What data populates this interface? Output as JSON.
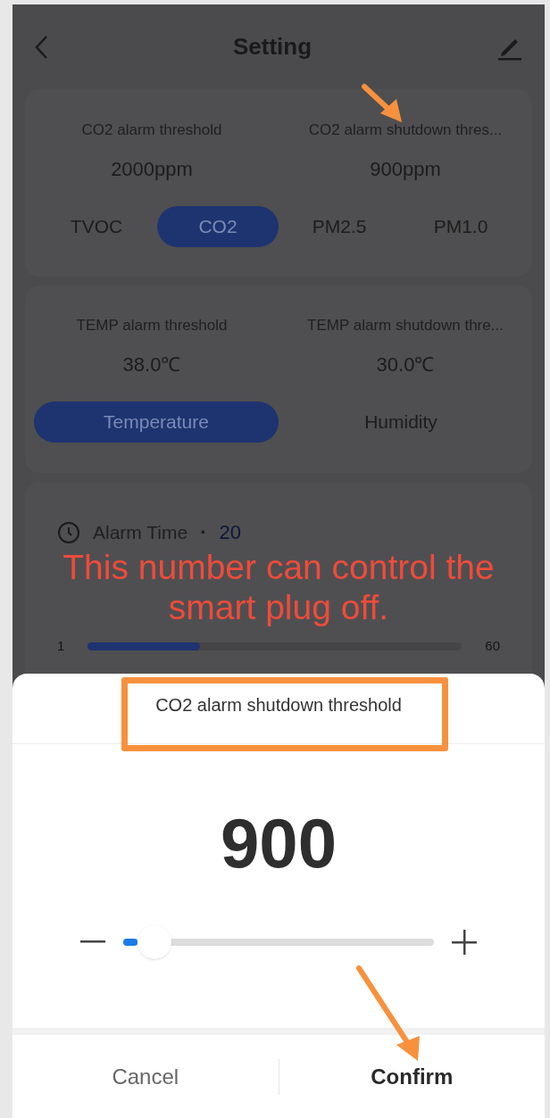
{
  "header": {
    "title": "Setting"
  },
  "air_card": {
    "readings": [
      {
        "label": "CO2 alarm threshold",
        "value": "2000ppm"
      },
      {
        "label": "CO2 alarm shutdown thres...",
        "value": "900ppm"
      }
    ],
    "tabs": [
      {
        "label": "TVOC",
        "selected": false
      },
      {
        "label": "CO2",
        "selected": true
      },
      {
        "label": "PM2.5",
        "selected": false
      },
      {
        "label": "PM1.0",
        "selected": false
      }
    ]
  },
  "temp_card": {
    "readings": [
      {
        "label": "TEMP alarm threshold",
        "value": "38.0℃"
      },
      {
        "label": "TEMP alarm shutdown thre...",
        "value": "30.0℃"
      }
    ],
    "tabs": [
      {
        "label": "Temperature",
        "selected": true
      },
      {
        "label": "Humidity",
        "selected": false
      }
    ]
  },
  "alarm_time": {
    "label": "Alarm Time",
    "separator": "·",
    "value": "20",
    "min": "1",
    "max": "60",
    "level": 0.3
  },
  "sheet": {
    "title": "CO2 alarm shutdown threshold",
    "value": "900",
    "level": 0.1,
    "buttons": [
      {
        "label": "Cancel",
        "kind": "cancel"
      },
      {
        "label": "Confirm",
        "kind": "confirm"
      }
    ]
  },
  "annotation": {
    "caption": "This number can control the smart plug off."
  }
}
